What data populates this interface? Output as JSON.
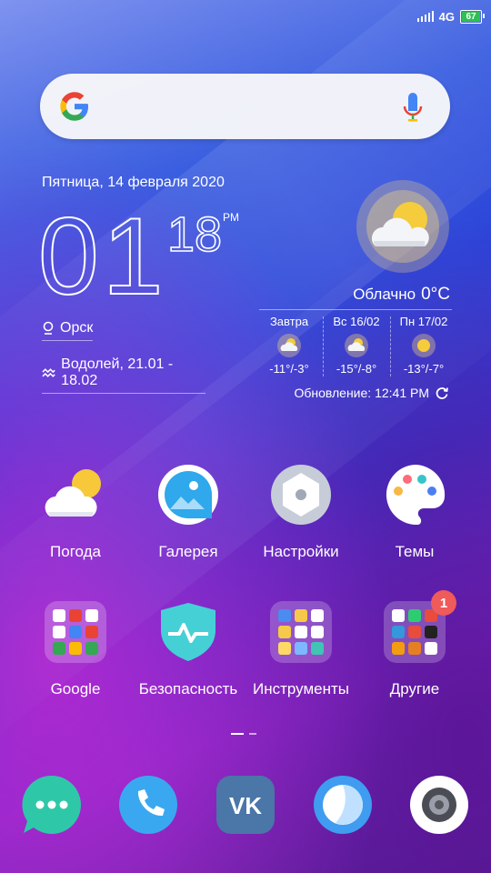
{
  "status_bar": {
    "network": "4G",
    "battery": "67"
  },
  "search": {
    "logo_icon": "google-logo-icon",
    "mic_icon": "microphone-icon"
  },
  "clock_widget": {
    "date": "Пятница, 14 февраля 2020",
    "hours": "01",
    "minutes": "18",
    "ampm": "PM",
    "location": "Орск",
    "zodiac": "Водолей, 21.01 - 18.02"
  },
  "weather": {
    "condition": "Облачно",
    "temperature": "0°C",
    "forecast": [
      {
        "day": "Завтра",
        "temps": "-11°/-3°",
        "icon": "partly-cloudy-icon"
      },
      {
        "day": "Вс 16/02",
        "temps": "-15°/-8°",
        "icon": "partly-cloudy-icon"
      },
      {
        "day": "Пн 17/02",
        "temps": "-13°/-7°",
        "icon": "sunny-icon"
      }
    ],
    "updated": "Обновление: 12:41 PM"
  },
  "apps_row1": [
    {
      "label": "Погода",
      "icon": "weather-app-icon"
    },
    {
      "label": "Галерея",
      "icon": "gallery-app-icon"
    },
    {
      "label": "Настройки",
      "icon": "settings-app-icon"
    },
    {
      "label": "Темы",
      "icon": "themes-app-icon"
    }
  ],
  "apps_row2": [
    {
      "label": "Google",
      "icon": "google-folder-icon"
    },
    {
      "label": "Безопасность",
      "icon": "security-app-icon"
    },
    {
      "label": "Инструменты",
      "icon": "tools-folder-icon"
    },
    {
      "label": "Другие",
      "icon": "other-folder-icon",
      "badge": "1"
    }
  ],
  "dock": [
    {
      "icon": "messages-icon",
      "color": "#2ec8a8"
    },
    {
      "icon": "phone-icon",
      "color": "#3aa8f0"
    },
    {
      "icon": "vk-icon",
      "color": "#4a76a8"
    },
    {
      "icon": "browser-icon",
      "color": "#3f9cf0"
    },
    {
      "icon": "camera-icon",
      "color": "#ffffff"
    }
  ]
}
